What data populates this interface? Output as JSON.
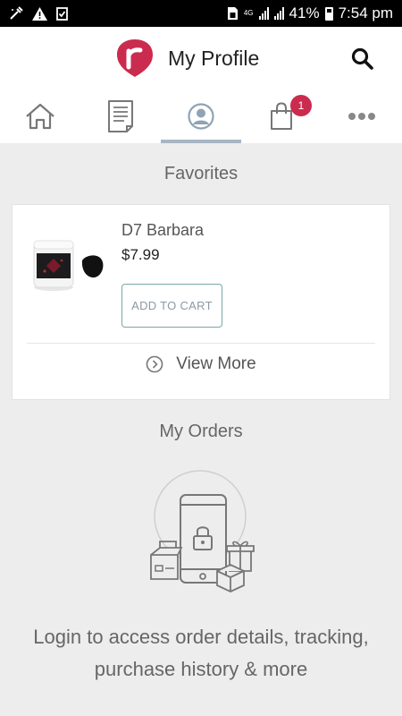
{
  "status_bar": {
    "network": "4G",
    "battery": "41%",
    "time": "7:54 pm"
  },
  "header": {
    "title": "My Profile"
  },
  "nav": {
    "tabs": [
      {
        "label": "Home",
        "icon": "home-icon"
      },
      {
        "label": "Orders",
        "icon": "document-icon"
      },
      {
        "label": "Profile",
        "icon": "profile-icon",
        "active": true
      },
      {
        "label": "Cart",
        "icon": "shopping-bag-icon",
        "badge": "1"
      },
      {
        "label": "More",
        "icon": "more-icon"
      }
    ]
  },
  "favorites": {
    "title": "Favorites",
    "items": [
      {
        "name": "D7 Barbara",
        "price": "$7.99",
        "button": "ADD TO CART"
      }
    ],
    "view_more": "View More"
  },
  "orders": {
    "title": "My Orders",
    "message": "Login to access order details, tracking, purchase history & more"
  },
  "colors": {
    "brand": "#cb2b4e",
    "active_tab": "#a7b6c4",
    "button_border": "#7aa6a8"
  }
}
